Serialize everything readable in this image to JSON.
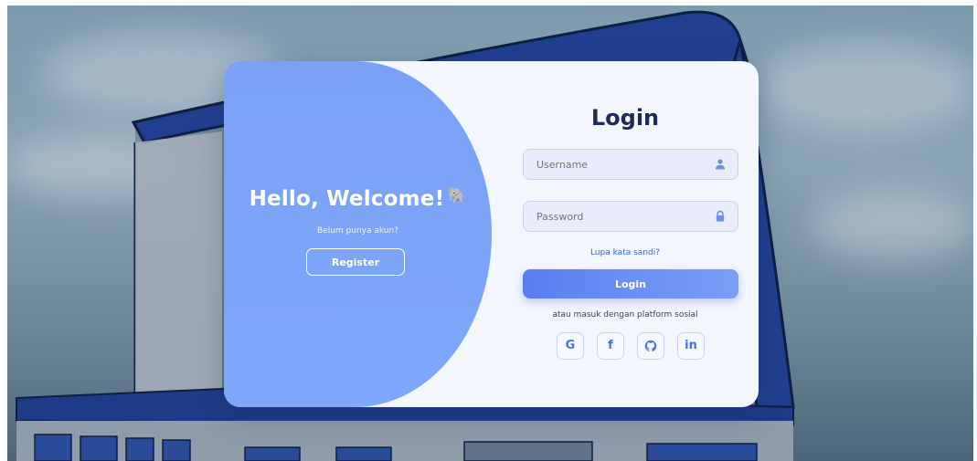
{
  "welcome_panel": {
    "heading": "Hello, Welcome!",
    "emoji": "🐘",
    "subtext": "Belum punya akun?",
    "register_label": "Register"
  },
  "login_form": {
    "title": "Login",
    "username_placeholder": "Username",
    "username_icon": "user-icon",
    "password_placeholder": "Password",
    "password_icon": "lock-icon",
    "forgot_label": "Lupa kata sandi?",
    "submit_label": "Login",
    "social_text": "atau masuk dengan platform sosial",
    "social": [
      {
        "label": "G",
        "icon": "google-icon"
      },
      {
        "label": "f",
        "icon": "facebook-icon"
      },
      {
        "label": "",
        "icon": "github-icon"
      },
      {
        "label": "in",
        "icon": "linkedin-icon"
      }
    ]
  },
  "colors": {
    "accent": "#7aa1f5",
    "button_gradient_start": "#5a7ef0",
    "button_gradient_end": "#7b9ff7",
    "title": "#1f2a5a",
    "link": "#3f63d8",
    "card_bg": "#f3f6fd"
  }
}
